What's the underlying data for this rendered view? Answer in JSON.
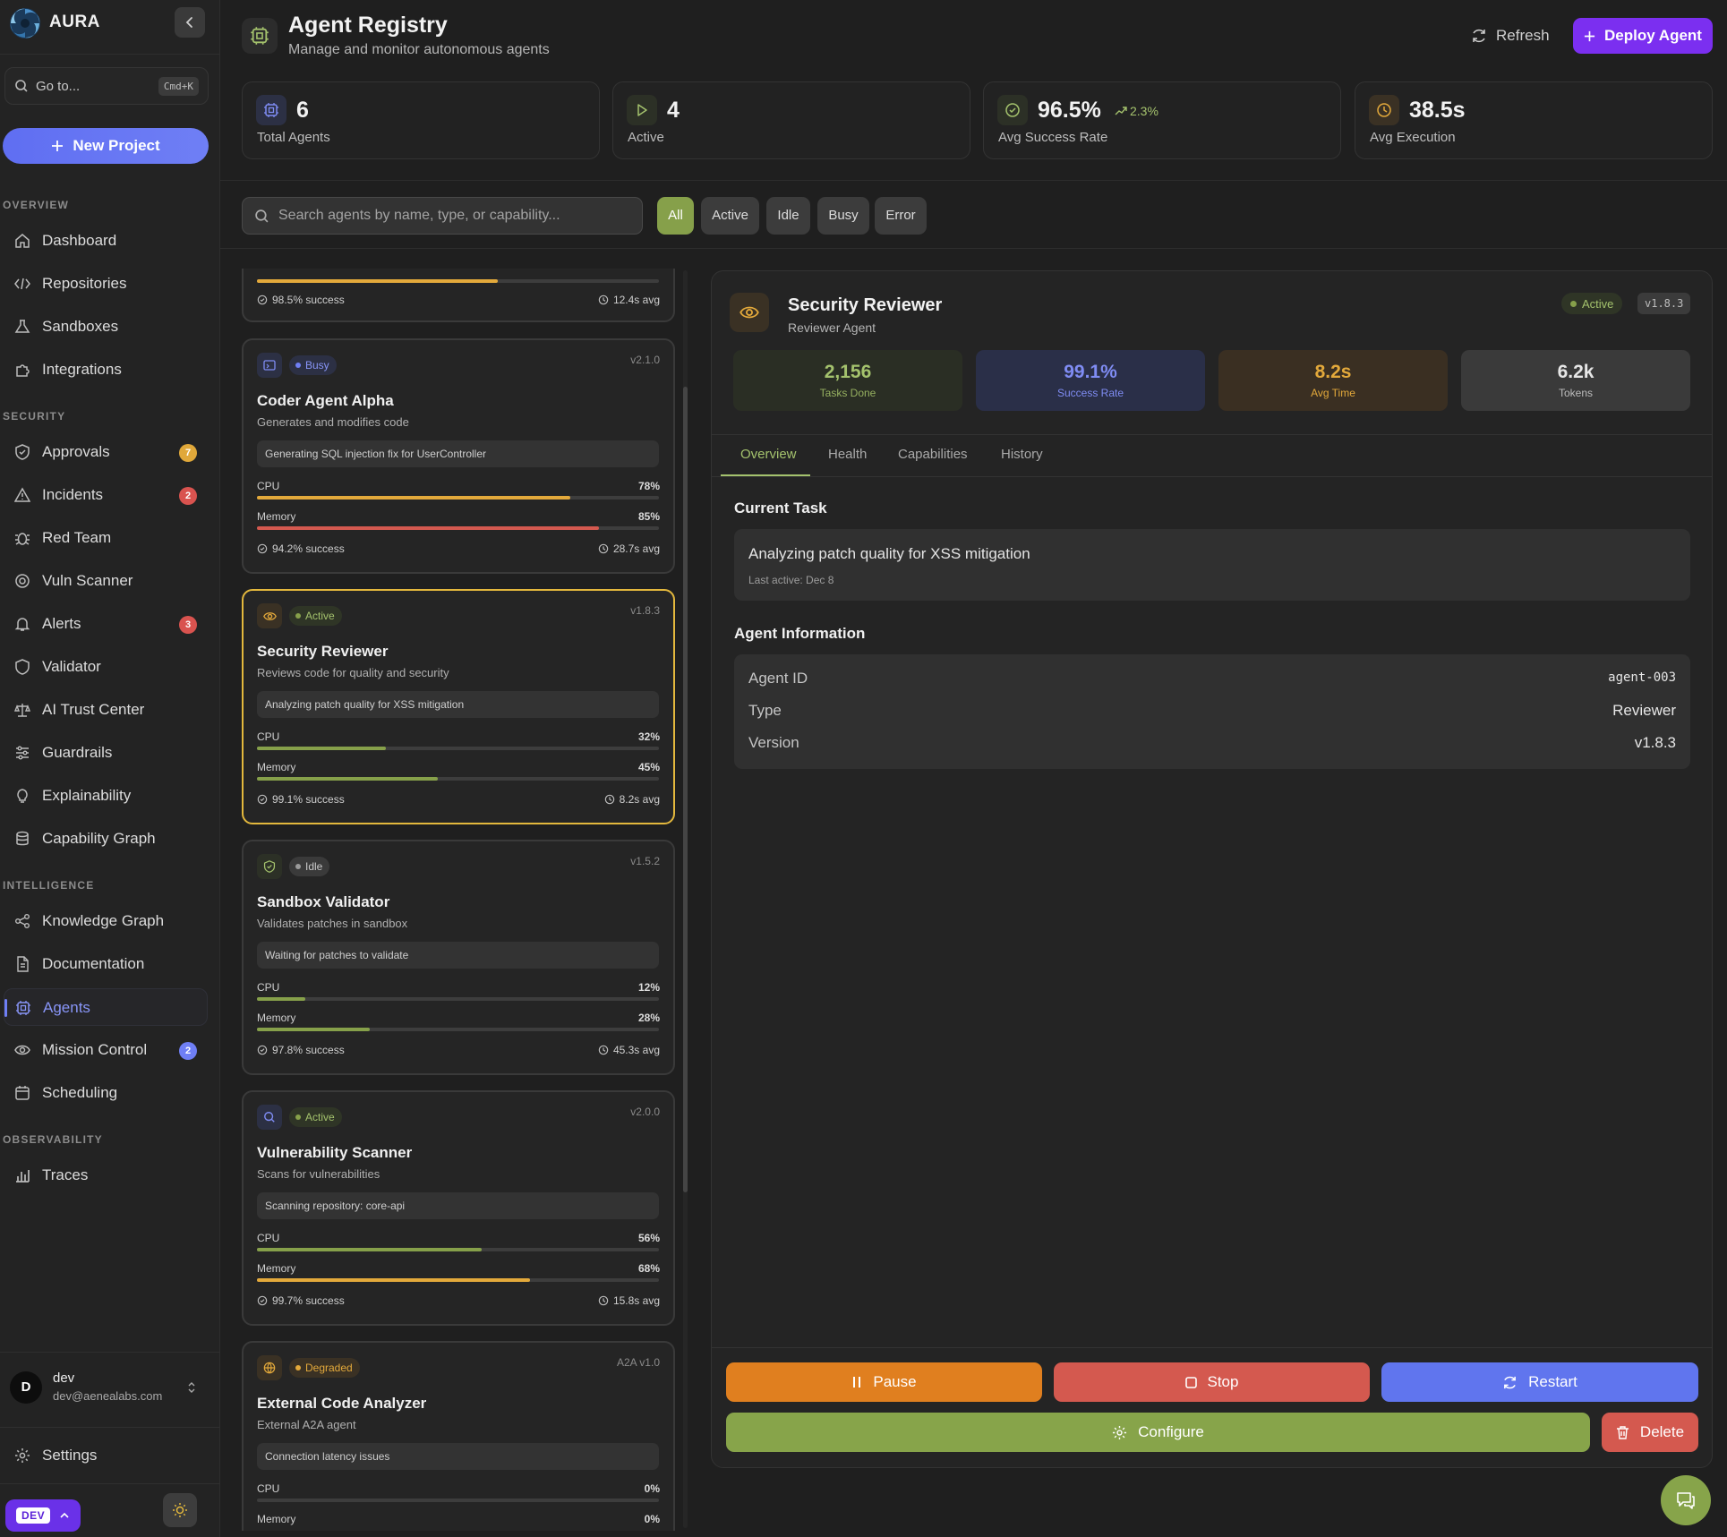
{
  "app": {
    "name": "AURA"
  },
  "sidebar": {
    "goto_label": "Go to...",
    "goto_shortcut": "Cmd+K",
    "new_project_label": "New Project",
    "sections": {
      "overview": "OVERVIEW",
      "security": "SECURITY",
      "intelligence": "INTELLIGENCE",
      "observability": "OBSERVABILITY"
    },
    "items": [
      {
        "label": "Dashboard",
        "icon": "home-icon"
      },
      {
        "label": "Repositories",
        "icon": "code-icon"
      },
      {
        "label": "Sandboxes",
        "icon": "flask-icon"
      },
      {
        "label": "Integrations",
        "icon": "puzzle-icon"
      },
      {
        "label": "Approvals",
        "icon": "shield-check-icon",
        "badge": "7"
      },
      {
        "label": "Incidents",
        "icon": "warning-icon",
        "badge": "2"
      },
      {
        "label": "Red Team",
        "icon": "bug-icon"
      },
      {
        "label": "Vuln Scanner",
        "icon": "scan-icon"
      },
      {
        "label": "Alerts",
        "icon": "bell-icon",
        "badge": "3"
      },
      {
        "label": "Validator",
        "icon": "shield-icon"
      },
      {
        "label": "AI Trust Center",
        "icon": "scale-icon"
      },
      {
        "label": "Guardrails",
        "icon": "sliders-icon"
      },
      {
        "label": "Explainability",
        "icon": "lightbulb-icon"
      },
      {
        "label": "Capability Graph",
        "icon": "database-icon"
      },
      {
        "label": "Knowledge Graph",
        "icon": "share-icon"
      },
      {
        "label": "Documentation",
        "icon": "document-icon"
      },
      {
        "label": "Agents",
        "icon": "cpu-icon"
      },
      {
        "label": "Mission Control",
        "icon": "eye-icon",
        "badge": "2"
      },
      {
        "label": "Scheduling",
        "icon": "calendar-icon"
      },
      {
        "label": "Traces",
        "icon": "bar-chart-icon"
      }
    ],
    "user": {
      "initial": "D",
      "name": "dev",
      "email": "dev@aenealabs.com"
    },
    "settings_label": "Settings",
    "env_label": "DEV",
    "colors": {
      "accent": "#6f7ff5",
      "badge_yellow": "#e0a83a",
      "badge_red": "#d9534f",
      "badge_blue": "#6f7ff5"
    }
  },
  "header": {
    "title": "Agent Registry",
    "subtitle": "Manage and monitor autonomous agents",
    "refresh_label": "Refresh",
    "deploy_label": "Deploy Agent"
  },
  "stats": [
    {
      "value": "6",
      "label": "Total Agents",
      "icon": "cpu-icon"
    },
    {
      "value": "4",
      "label": "Active",
      "icon": "play-icon"
    },
    {
      "value": "96.5%",
      "label": "Avg Success Rate",
      "icon": "check-circle-icon",
      "trend": "2.3%"
    },
    {
      "value": "38.5s",
      "label": "Avg Execution",
      "icon": "clock-icon"
    }
  ],
  "filters": {
    "search_placeholder": "Search agents by name, type, or capability...",
    "chips": [
      "All",
      "Active",
      "Idle",
      "Busy",
      "Error"
    ],
    "selected": "All"
  },
  "agents": [
    {
      "name": "",
      "description": "",
      "status": "",
      "version": "",
      "task": "",
      "cpu": 0,
      "memory": 60,
      "success": "98.5% success",
      "avg": "12.4s avg"
    },
    {
      "name": "Coder Agent Alpha",
      "description": "Generates and modifies code",
      "status": "Busy",
      "version": "v2.1.0",
      "task": "Generating SQL injection fix for UserController",
      "cpu_label": "CPU",
      "memory_label": "Memory",
      "cpu": 78,
      "memory": 85,
      "cpu_text": "78%",
      "memory_text": "85%",
      "success": "94.2% success",
      "avg": "28.7s avg",
      "icon": "terminal-icon"
    },
    {
      "name": "Security Reviewer",
      "description": "Reviews code for quality and security",
      "status": "Active",
      "version": "v1.8.3",
      "task": "Analyzing patch quality for XSS mitigation",
      "cpu_label": "CPU",
      "memory_label": "Memory",
      "cpu": 32,
      "memory": 45,
      "cpu_text": "32%",
      "memory_text": "45%",
      "success": "99.1% success",
      "avg": "8.2s avg",
      "icon": "eye-icon"
    },
    {
      "name": "Sandbox Validator",
      "description": "Validates patches in sandbox",
      "status": "Idle",
      "version": "v1.5.2",
      "task": "Waiting for patches to validate",
      "cpu_label": "CPU",
      "memory_label": "Memory",
      "cpu": 12,
      "memory": 28,
      "cpu_text": "12%",
      "memory_text": "28%",
      "success": "97.8% success",
      "avg": "45.3s avg",
      "icon": "shield-check-icon"
    },
    {
      "name": "Vulnerability Scanner",
      "description": "Scans for vulnerabilities",
      "status": "Active",
      "version": "v2.0.0",
      "task": "Scanning repository: core-api",
      "cpu_label": "CPU",
      "memory_label": "Memory",
      "cpu": 56,
      "memory": 68,
      "cpu_text": "56%",
      "memory_text": "68%",
      "success": "99.7% success",
      "avg": "15.8s avg",
      "icon": "search-icon"
    },
    {
      "name": "External Code Analyzer",
      "description": "External A2A agent",
      "status": "Degraded",
      "version": "A2A v1.0",
      "task": "Connection latency issues",
      "cpu_label": "CPU",
      "memory_label": "Memory",
      "cpu": 0,
      "memory": 0,
      "cpu_text": "0%",
      "memory_text": "0%",
      "icon": "globe-icon"
    }
  ],
  "detail": {
    "name": "Security Reviewer",
    "type": "Reviewer Agent",
    "status": "Active",
    "version": "v1.8.3",
    "stats": [
      {
        "value": "2,156",
        "label": "Tasks Done"
      },
      {
        "value": "99.1%",
        "label": "Success Rate"
      },
      {
        "value": "8.2s",
        "label": "Avg Time"
      },
      {
        "value": "6.2k",
        "label": "Tokens"
      }
    ],
    "tabs": [
      "Overview",
      "Health",
      "Capabilities",
      "History"
    ],
    "active_tab": "Overview",
    "current_task_heading": "Current Task",
    "current_task": "Analyzing patch quality for XSS mitigation",
    "last_active": "Last active: Dec 8",
    "info_heading": "Agent Information",
    "info": [
      {
        "key": "Agent ID",
        "value": "agent-003"
      },
      {
        "key": "Type",
        "value": "Reviewer"
      },
      {
        "key": "Version",
        "value": "v1.8.3"
      }
    ],
    "actions": {
      "pause": "Pause",
      "stop": "Stop",
      "restart": "Restart",
      "configure": "Configure",
      "delete": "Delete"
    },
    "colors": {
      "pause": "#e07f1f",
      "stop": "#d4594f",
      "restart": "#6075ee",
      "configure": "#87a44a",
      "delete": "#d4594f"
    }
  }
}
